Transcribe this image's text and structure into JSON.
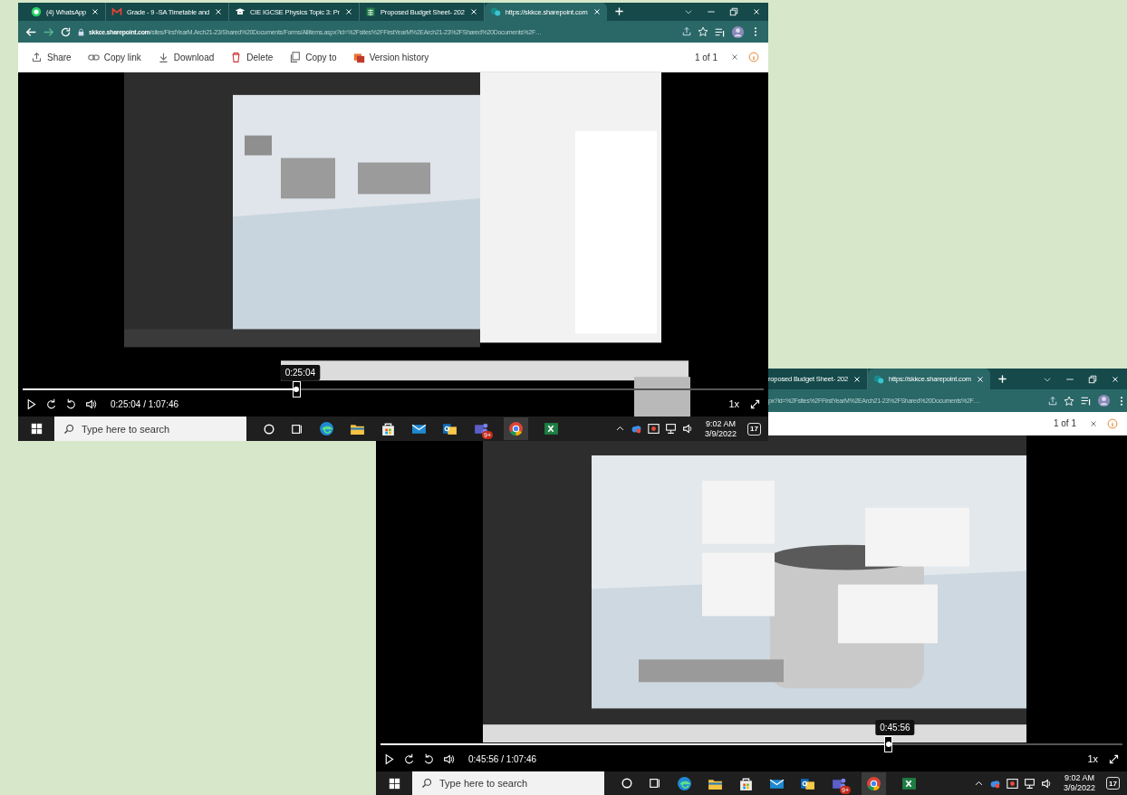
{
  "screenshots": [
    {
      "kind": "full",
      "tabs": [
        {
          "kind": "whatsapp",
          "title": "(4) WhatsApp",
          "selected": false
        },
        {
          "kind": "mail",
          "title": "Grade - 9 -SA Timetable and",
          "selected": false
        },
        {
          "kind": "school",
          "title": "CIE IGCSE Physics Topic 3: Pr",
          "selected": false
        },
        {
          "kind": "sheet",
          "title": "Proposed Budget Sheet- 202",
          "selected": false
        },
        {
          "kind": "sharepoint",
          "title": "https://skkce.sharepoint.com",
          "selected": true
        }
      ],
      "address": "**skkce.sharepoint.com**/sites/FirstYearM.Arch21-23/Shared%20Documents/Forms/AllItems.aspx?id=%2Fsites%2FFirstYearM%2EArch21-23%2FShared%20Documents%2F…",
      "actions": [
        "Share",
        "Copy link",
        "Download",
        "Delete",
        "Copy to",
        "Version history"
      ],
      "page_count": "1 of 1",
      "video": {
        "tooltip": "0:25:04",
        "level": 0.37,
        "time": "0:25:04 / 1:07:46",
        "speed": "1x"
      },
      "taskbar": {
        "search_placeholder": "Type here to search",
        "badge": "9+",
        "time": "9:02 AM",
        "date": "3/9/2022",
        "notifications": "17"
      }
    },
    {
      "kind": "partial",
      "tabs": [
        {
          "kind": "partial",
          "title": "roposed Budget Sheet- 202",
          "selected": false
        },
        {
          "kind": "sharepoint",
          "title": "https://skkce.sharepoint.com",
          "selected": true
        }
      ],
      "address": "px?id=%2Fsites%2FFirstYearM%2EArch21-23%2FShared%20Documents%2F…",
      "page_count": "1 of 1",
      "video": {
        "tooltip": "0:45:56",
        "level": 0.685,
        "time": "0:45:56 / 1:07:46",
        "speed": "1x"
      },
      "taskbar": {
        "search_placeholder": "Type here to search",
        "badge": "9+",
        "time": "9:02 AM",
        "date": "3/9/2022",
        "notifications": "17"
      }
    }
  ]
}
